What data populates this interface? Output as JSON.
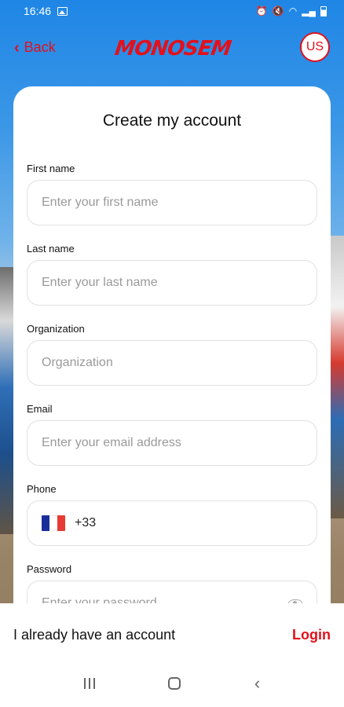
{
  "status_bar": {
    "time": "16:46"
  },
  "header": {
    "back_label": "Back",
    "logo": "MONOSEM",
    "language": "US"
  },
  "form": {
    "title": "Create my account",
    "fields": [
      {
        "label": "First name",
        "placeholder": "Enter your first name"
      },
      {
        "label": "Last name",
        "placeholder": "Enter your last name"
      },
      {
        "label": "Organization",
        "placeholder": "Organization"
      },
      {
        "label": "Email",
        "placeholder": "Enter your email address"
      },
      {
        "label": "Phone",
        "value": "+33",
        "country": "France"
      },
      {
        "label": "Password",
        "placeholder": "Enter your password"
      }
    ]
  },
  "footer": {
    "have_account": "I already have an account",
    "login": "Login"
  },
  "colors": {
    "accent": "#e3101b"
  }
}
